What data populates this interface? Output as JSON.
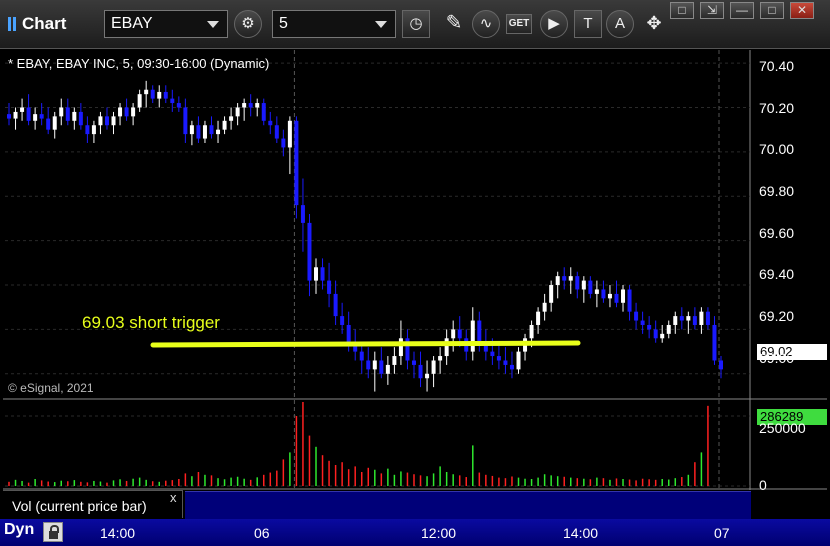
{
  "app": {
    "title": "Chart"
  },
  "toolbar": {
    "symbol": "EBAY",
    "interval": "5",
    "icons": [
      "gear-icon",
      "clock-icon",
      "pencil-icon",
      "study-icon",
      "get-icon",
      "play-icon",
      "text-icon",
      "alert-icon",
      "cursor-icon"
    ],
    "get_label": "GET"
  },
  "window_controls": [
    "restore",
    "tile",
    "maximize",
    "close"
  ],
  "chart_header": "* EBAY, EBAY INC, 5, 09:30-16:00 (Dynamic)",
  "copyright": "© eSignal, 2021",
  "annotation": "69.03 short trigger",
  "last_price": "69.02",
  "last_volume": "286289",
  "volume_legend": "Vol (current price bar)",
  "volume_legend_close": "x",
  "bottom_bar": {
    "mode": "Dyn"
  },
  "colors": {
    "up": "#ffffff",
    "down": "#1a1aff",
    "vol_up": "#2ee82e",
    "vol_down": "#ff2020",
    "trigger_line": "#e8ff1a",
    "bottom_bar": "#000080"
  },
  "chart_data": [
    {
      "type": "candlestick",
      "title": "EBAY, EBAY INC, 5, 09:30-16:00 (Dynamic)",
      "y_ticks": [
        "70.40",
        "70.20",
        "70.00",
        "69.80",
        "69.60",
        "69.40",
        "69.20",
        "69.00"
      ],
      "ylim": [
        68.9,
        70.45
      ],
      "x_ticks": [
        "14:00",
        "06",
        "12:00",
        "14:00",
        "07"
      ],
      "grid": true,
      "ohlc": [
        [
          70.17,
          70.22,
          70.12,
          70.15
        ],
        [
          70.15,
          70.2,
          70.1,
          70.18
        ],
        [
          70.18,
          70.24,
          70.14,
          70.2
        ],
        [
          70.2,
          70.26,
          70.12,
          70.14
        ],
        [
          70.14,
          70.2,
          70.1,
          70.17
        ],
        [
          70.17,
          70.22,
          70.12,
          70.15
        ],
        [
          70.15,
          70.2,
          70.08,
          70.1
        ],
        [
          70.1,
          70.18,
          70.06,
          70.16
        ],
        [
          70.16,
          70.24,
          70.12,
          70.2
        ],
        [
          70.2,
          70.24,
          70.12,
          70.14
        ],
        [
          70.14,
          70.2,
          70.1,
          70.18
        ],
        [
          70.18,
          70.22,
          70.1,
          70.12
        ],
        [
          70.12,
          70.16,
          70.04,
          70.08
        ],
        [
          70.08,
          70.14,
          70.04,
          70.12
        ],
        [
          70.12,
          70.18,
          70.08,
          70.16
        ],
        [
          70.16,
          70.2,
          70.1,
          70.12
        ],
        [
          70.12,
          70.18,
          70.08,
          70.16
        ],
        [
          70.16,
          70.22,
          70.12,
          70.2
        ],
        [
          70.2,
          70.24,
          70.14,
          70.16
        ],
        [
          70.16,
          70.22,
          70.12,
          70.2
        ],
        [
          70.2,
          70.28,
          70.18,
          70.26
        ],
        [
          70.26,
          70.32,
          70.2,
          70.28
        ],
        [
          70.28,
          70.3,
          70.22,
          70.24
        ],
        [
          70.24,
          70.3,
          70.2,
          70.27
        ],
        [
          70.27,
          70.3,
          70.22,
          70.24
        ],
        [
          70.24,
          70.28,
          70.18,
          70.22
        ],
        [
          70.22,
          70.25,
          70.18,
          70.2
        ],
        [
          70.2,
          70.24,
          70.04,
          70.08
        ],
        [
          70.08,
          70.14,
          70.03,
          70.12
        ],
        [
          70.12,
          70.16,
          70.04,
          70.06
        ],
        [
          70.06,
          70.14,
          70.04,
          70.12
        ],
        [
          70.12,
          70.16,
          70.06,
          70.08
        ],
        [
          70.08,
          70.14,
          70.04,
          70.1
        ],
        [
          70.1,
          70.16,
          70.08,
          70.14
        ],
        [
          70.14,
          70.2,
          70.1,
          70.16
        ],
        [
          70.16,
          70.22,
          70.12,
          70.2
        ],
        [
          70.2,
          70.24,
          70.14,
          70.22
        ],
        [
          70.22,
          70.26,
          70.16,
          70.2
        ],
        [
          70.2,
          70.24,
          70.16,
          70.22
        ],
        [
          70.22,
          70.24,
          70.12,
          70.14
        ],
        [
          70.14,
          70.18,
          70.08,
          70.12
        ],
        [
          70.12,
          70.16,
          70.04,
          70.06
        ],
        [
          70.06,
          70.1,
          69.98,
          70.02
        ],
        [
          70.02,
          70.16,
          69.9,
          70.14
        ],
        [
          70.14,
          70.16,
          69.7,
          69.76
        ],
        [
          69.76,
          69.88,
          69.55,
          69.68
        ],
        [
          69.68,
          69.72,
          69.35,
          69.42
        ],
        [
          69.42,
          69.52,
          69.36,
          69.48
        ],
        [
          69.48,
          69.52,
          69.38,
          69.42
        ],
        [
          69.42,
          69.5,
          69.3,
          69.36
        ],
        [
          69.36,
          69.42,
          69.22,
          69.26
        ],
        [
          69.26,
          69.32,
          69.18,
          69.22
        ],
        [
          69.22,
          69.28,
          69.1,
          69.14
        ],
        [
          69.14,
          69.2,
          69.06,
          69.1
        ],
        [
          69.1,
          69.14,
          69.0,
          69.06
        ],
        [
          69.06,
          69.12,
          68.98,
          69.02
        ],
        [
          69.02,
          69.1,
          68.92,
          69.06
        ],
        [
          69.06,
          69.12,
          68.98,
          69.0
        ],
        [
          69.0,
          69.08,
          68.95,
          69.04
        ],
        [
          69.04,
          69.12,
          69.0,
          69.08
        ],
        [
          69.08,
          69.24,
          69.04,
          69.16
        ],
        [
          69.16,
          69.2,
          69.02,
          69.06
        ],
        [
          69.06,
          69.1,
          68.98,
          69.04
        ],
        [
          69.04,
          69.1,
          68.94,
          68.98
        ],
        [
          68.98,
          69.06,
          68.92,
          69.0
        ],
        [
          69.0,
          69.08,
          68.94,
          69.06
        ],
        [
          69.06,
          69.12,
          69.0,
          69.08
        ],
        [
          69.08,
          69.2,
          69.04,
          69.16
        ],
        [
          69.16,
          69.24,
          69.1,
          69.2
        ],
        [
          69.2,
          69.26,
          69.12,
          69.16
        ],
        [
          69.16,
          69.2,
          69.06,
          69.1
        ],
        [
          69.1,
          69.3,
          69.06,
          69.24
        ],
        [
          69.24,
          69.28,
          69.1,
          69.14
        ],
        [
          69.14,
          69.2,
          69.06,
          69.1
        ],
        [
          69.1,
          69.16,
          69.04,
          69.08
        ],
        [
          69.08,
          69.14,
          69.02,
          69.06
        ],
        [
          69.06,
          69.12,
          69.0,
          69.04
        ],
        [
          69.04,
          69.1,
          68.98,
          69.02
        ],
        [
          69.02,
          69.12,
          69.0,
          69.1
        ],
        [
          69.1,
          69.18,
          69.06,
          69.16
        ],
        [
          69.16,
          69.24,
          69.12,
          69.22
        ],
        [
          69.22,
          69.3,
          69.18,
          69.28
        ],
        [
          69.28,
          69.36,
          69.24,
          69.32
        ],
        [
          69.32,
          69.42,
          69.28,
          69.4
        ],
        [
          69.4,
          69.46,
          69.34,
          69.44
        ],
        [
          69.44,
          69.48,
          69.38,
          69.42
        ],
        [
          69.42,
          69.48,
          69.36,
          69.44
        ],
        [
          69.44,
          69.46,
          69.34,
          69.38
        ],
        [
          69.38,
          69.44,
          69.32,
          69.42
        ],
        [
          69.42,
          69.44,
          69.34,
          69.36
        ],
        [
          69.36,
          69.42,
          69.3,
          69.38
        ],
        [
          69.38,
          69.42,
          69.32,
          69.34
        ],
        [
          69.34,
          69.4,
          69.3,
          69.36
        ],
        [
          69.36,
          69.42,
          69.3,
          69.32
        ],
        [
          69.32,
          69.4,
          69.28,
          69.38
        ],
        [
          69.38,
          69.4,
          69.24,
          69.28
        ],
        [
          69.28,
          69.32,
          69.2,
          69.24
        ],
        [
          69.24,
          69.28,
          69.18,
          69.22
        ],
        [
          69.22,
          69.26,
          69.16,
          69.2
        ],
        [
          69.2,
          69.24,
          69.14,
          69.16
        ],
        [
          69.16,
          69.22,
          69.14,
          69.18
        ],
        [
          69.18,
          69.24,
          69.16,
          69.22
        ],
        [
          69.22,
          69.28,
          69.18,
          69.26
        ],
        [
          69.26,
          69.3,
          69.2,
          69.24
        ],
        [
          69.24,
          69.28,
          69.18,
          69.26
        ],
        [
          69.26,
          69.3,
          69.2,
          69.22
        ],
        [
          69.22,
          69.3,
          69.18,
          69.28
        ],
        [
          69.28,
          69.3,
          69.2,
          69.22
        ],
        [
          69.22,
          69.26,
          69.04,
          69.06
        ],
        [
          69.06,
          69.08,
          68.98,
          69.02
        ]
      ],
      "volume_ticks": [
        "250000",
        "0"
      ],
      "volume_ylim": [
        0,
        300000
      ],
      "volume": [
        15000,
        22000,
        18000,
        12000,
        25000,
        20000,
        16000,
        14000,
        19000,
        17000,
        21000,
        15000,
        13000,
        18000,
        16000,
        12000,
        20000,
        24000,
        18000,
        26000,
        30000,
        22000,
        17000,
        15000,
        19000,
        21000,
        25000,
        45000,
        35000,
        50000,
        40000,
        38000,
        28000,
        24000,
        30000,
        33000,
        26000,
        22000,
        31000,
        40000,
        48000,
        55000,
        95000,
        120000,
        250000,
        300000,
        180000,
        140000,
        110000,
        90000,
        75000,
        85000,
        60000,
        70000,
        50000,
        65000,
        58000,
        45000,
        62000,
        40000,
        52000,
        48000,
        42000,
        38000,
        35000,
        45000,
        70000,
        50000,
        42000,
        38000,
        32000,
        145000,
        48000,
        40000,
        36000,
        30000,
        28000,
        34000,
        30000,
        26000,
        25000,
        30000,
        42000,
        38000,
        35000,
        33000,
        30000,
        28000,
        26000,
        24000,
        30000,
        28000,
        22000,
        27000,
        25000,
        23000,
        20000,
        26000,
        24000,
        22000,
        25000,
        23000,
        28000,
        32000,
        40000,
        85000,
        120000,
        286289
      ]
    }
  ]
}
